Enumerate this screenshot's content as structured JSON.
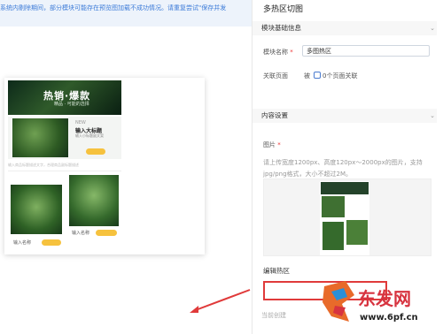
{
  "canvas": {
    "notice": "系统内剔除期间，部分模块可能存在预览图加载不成功情况。请重复尝试\"保存并发",
    "preview": {
      "hero_title": "热销·爆款",
      "hero_sub": "精品 · 可能的选择",
      "new_tag": "NEW",
      "row_title": "输入大标题",
      "row_sub": "输入小标题副文案",
      "caption": "输入商品标题描述文字，合理商品副标题描述",
      "item_label_b": "输入名称",
      "item_label_c": "输入名称"
    }
  },
  "panel": {
    "title": "多热区切图",
    "module_section": "模块基础信息",
    "module_name_label": "模块名称",
    "module_name_value": "多图热区",
    "assoc_label": "关联页面",
    "assoc_prefix": "被",
    "assoc_value": "0个页面关联",
    "content_section": "内容设置",
    "image_label": "图片",
    "hint": "请上传宽度1200px、高度120px～2000px的图片，支持jpg/png格式，大小不超过2M。",
    "hotzone_label": "编辑热区",
    "current_text": "当前创建"
  },
  "watermark": {
    "chinese": "东发网",
    "url": "www.6pf.cn"
  },
  "colors": {
    "accent_blue": "#3c7bd8",
    "highlight_red": "#e03a3a",
    "badge_yellow": "#f6c23e"
  }
}
